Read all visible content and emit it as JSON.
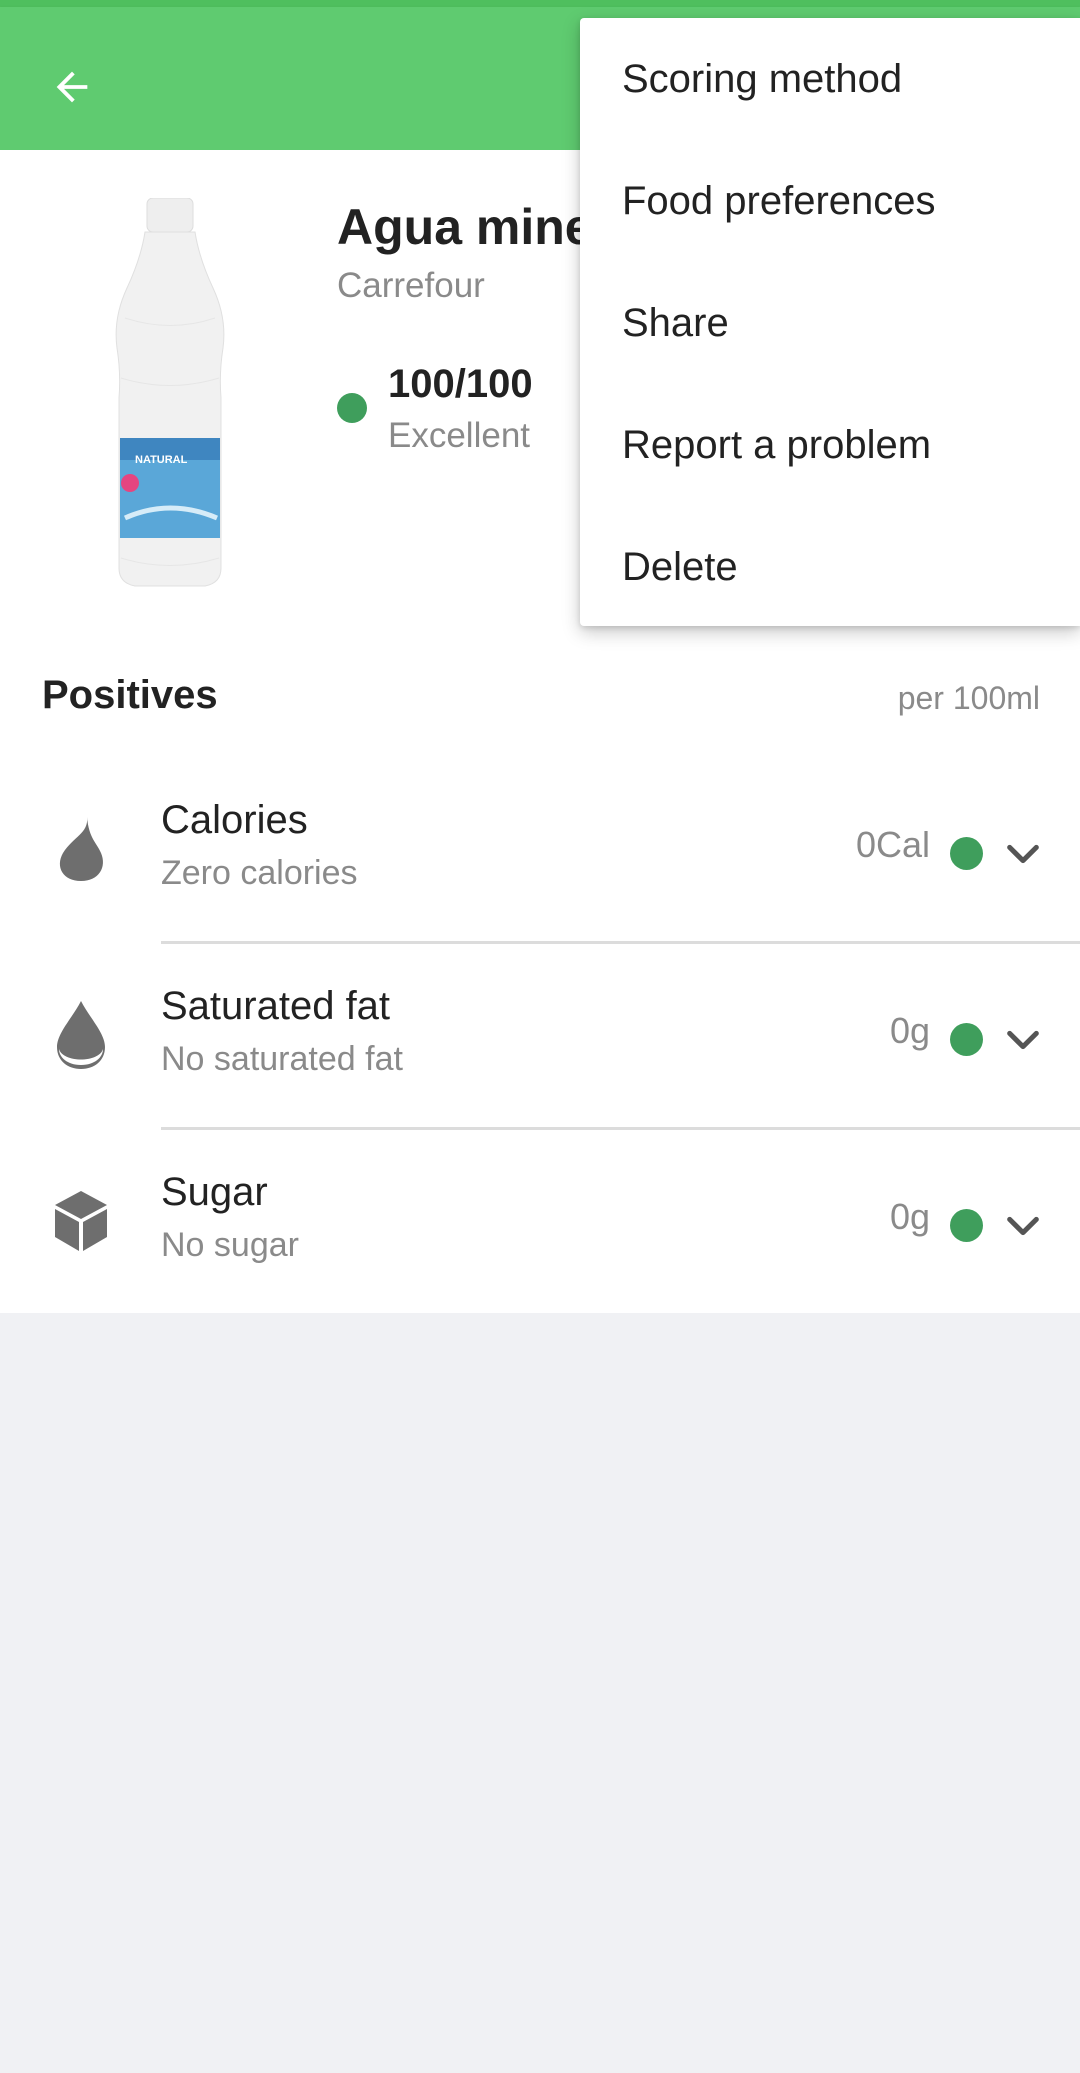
{
  "product": {
    "title": "Agua mine",
    "brand": "Carrefour",
    "score": "100/100",
    "score_label": "Excellent",
    "image_text": "NATURAL"
  },
  "section": {
    "title": "Positives",
    "unit": "per 100ml"
  },
  "nutrients": [
    {
      "name": "Calories",
      "description": "Zero calories",
      "value": "0Cal",
      "icon": "flame-icon"
    },
    {
      "name": "Saturated fat",
      "description": "No saturated fat",
      "value": "0g",
      "icon": "drop-icon"
    },
    {
      "name": "Sugar",
      "description": "No sugar",
      "value": "0g",
      "icon": "cube-icon"
    }
  ],
  "menu": {
    "items": [
      "Scoring method",
      "Food preferences",
      "Share",
      "Report a problem",
      "Delete"
    ]
  },
  "colors": {
    "appbar": "#5fcb70",
    "score_good": "#3f9e5c",
    "background": "#f0f1f4"
  }
}
